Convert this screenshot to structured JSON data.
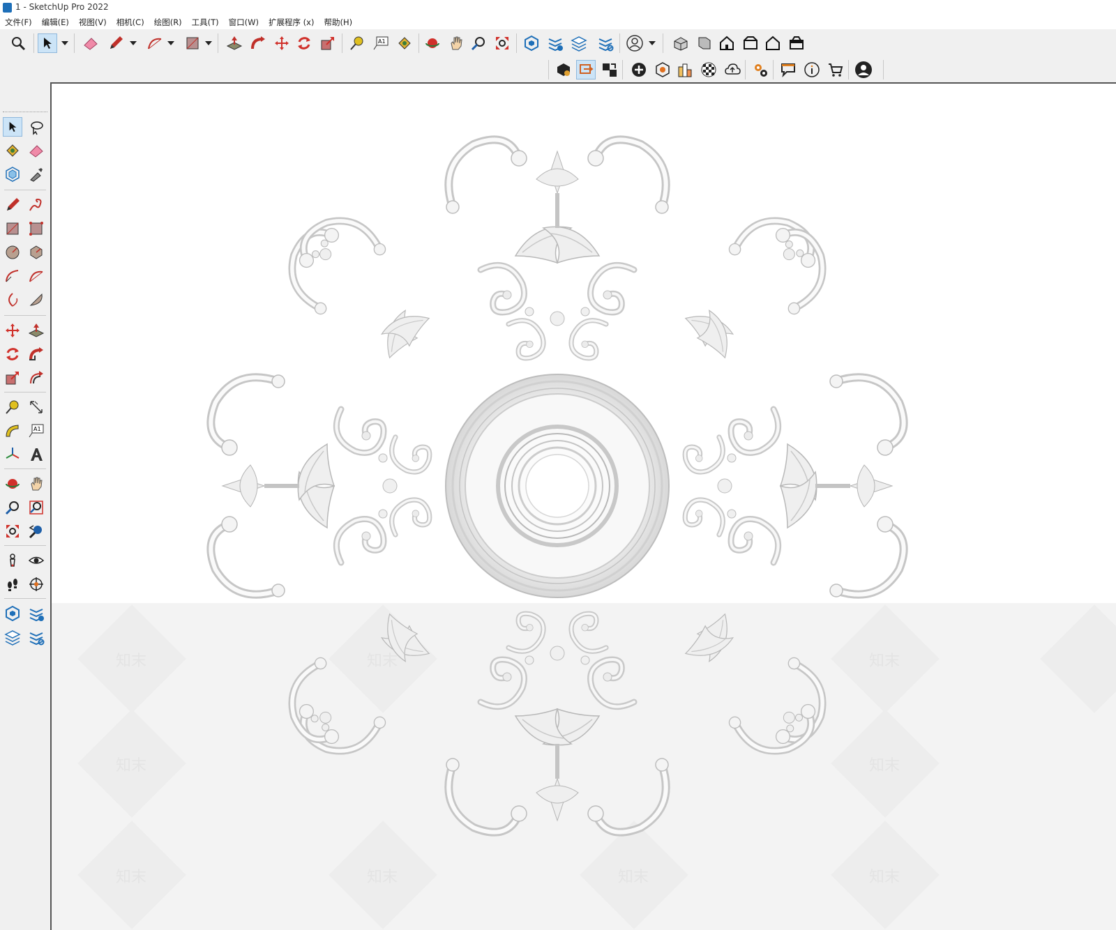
{
  "window": {
    "title": "1 - SketchUp Pro 2022"
  },
  "menu": [
    "文件(F)",
    "编辑(E)",
    "视图(V)",
    "相机(C)",
    "绘图(R)",
    "工具(T)",
    "窗口(W)",
    "扩展程序 (x)",
    "帮助(H)"
  ],
  "left_toolbar": {
    "text_tool_label": "A1"
  },
  "top_toolbar": {
    "text_tool_label": "A1"
  },
  "watermark": {
    "text": "知末"
  },
  "colors": {
    "accent": "#cce4f7",
    "viewport": "#ffffff",
    "ornament": "#d6d6d6"
  }
}
